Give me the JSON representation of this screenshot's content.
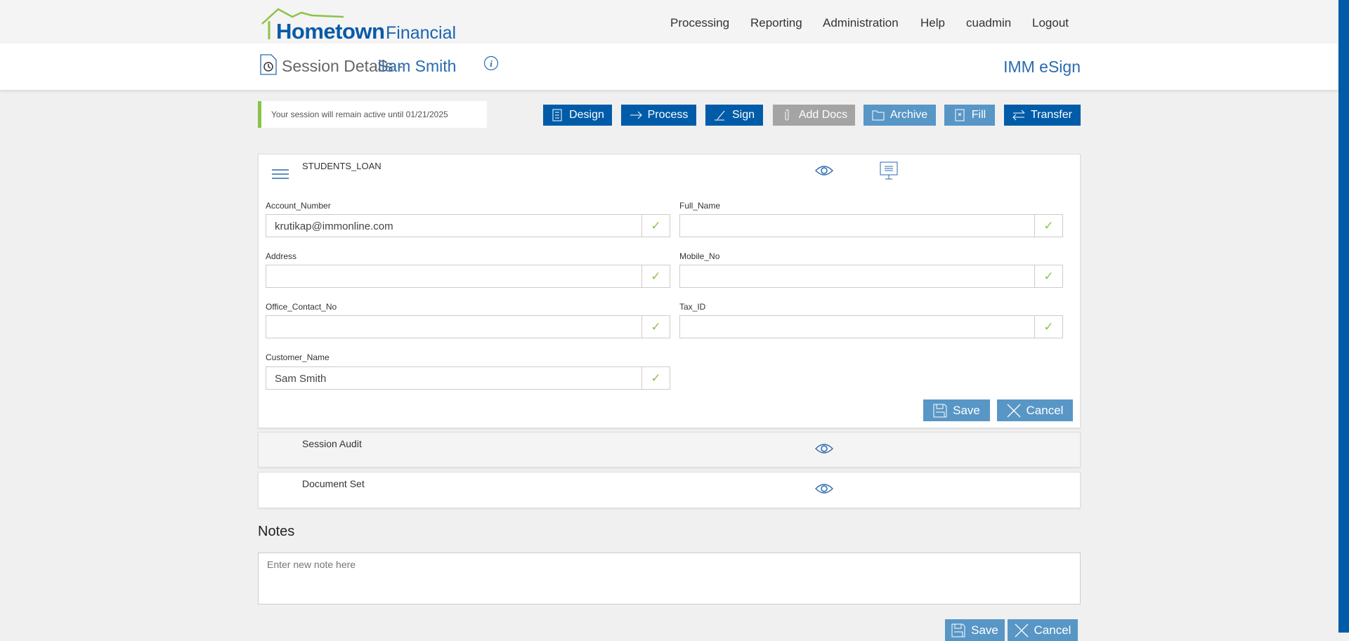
{
  "brand": {
    "name_bold": "Hometown",
    "name_light": "Financial"
  },
  "nav": [
    "Processing",
    "Reporting",
    "Administration",
    "Help",
    "cuadmin",
    "Logout"
  ],
  "page": {
    "title": "Session Details -",
    "customer": "Sam Smith",
    "app_name": "IMM eSign"
  },
  "notice": "Your session will remain active until 01/21/2025",
  "toolbar": [
    {
      "label": "Design",
      "icon": "document-list-icon",
      "style": "dark"
    },
    {
      "label": "Process",
      "icon": "arrow-right-icon",
      "style": "dark"
    },
    {
      "label": "Sign",
      "icon": "pen-icon",
      "style": "dark"
    },
    {
      "label": "Add Docs",
      "icon": "paperclip-icon",
      "style": "disabled"
    },
    {
      "label": "Archive",
      "icon": "folder-icon",
      "style": "light"
    },
    {
      "label": "Fill",
      "icon": "file-x-icon",
      "style": "light"
    },
    {
      "label": "Transfer",
      "icon": "swap-icon",
      "style": "dark"
    }
  ],
  "form": {
    "title": "STUDENTS_LOAN",
    "fields": [
      {
        "label": "Account_Number",
        "value": "krutikap@immonline.com"
      },
      {
        "label": "Full_Name",
        "value": ""
      },
      {
        "label": "Address",
        "value": ""
      },
      {
        "label": "Mobile_No",
        "value": ""
      },
      {
        "label": "Office_Contact_No",
        "value": ""
      },
      {
        "label": "Tax_ID",
        "value": ""
      },
      {
        "label": "Customer_Name",
        "value": "Sam Smith"
      }
    ],
    "check": "✓",
    "save": "Save",
    "cancel": "Cancel"
  },
  "sections": [
    "Session Audit",
    "Document Set"
  ],
  "notes": {
    "title": "Notes",
    "placeholder": "Enter new note here",
    "save": "Save",
    "cancel": "Cancel"
  },
  "colors": {
    "primary": "#005ca8",
    "light": "#5896c6",
    "accent": "#8bc34a"
  }
}
